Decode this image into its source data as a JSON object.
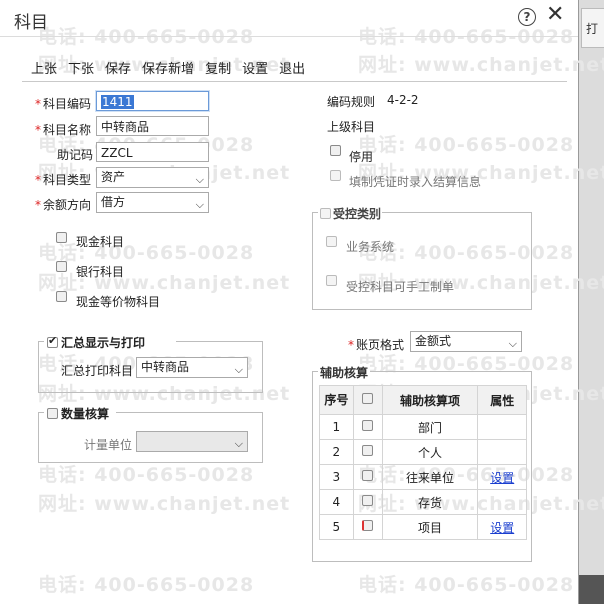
{
  "dialog": {
    "title": "科目",
    "help_glyph": "?",
    "close_glyph": "✕",
    "right_tab_label": "打"
  },
  "toolbar": [
    "上张",
    "下张",
    "保存",
    "保存新增",
    "复制",
    "设置",
    "退出"
  ],
  "watermark": {
    "phone": "电话: 400-665-0028",
    "site": "网址: www.chanjet.net"
  },
  "form": {
    "code_label": "科目编码",
    "code_value": "1411",
    "name_label": "科目名称",
    "name_value": "中转商品",
    "mnemonic_label": "助记码",
    "mnemonic_value": "ZZCL",
    "type_label": "科目类型",
    "type_value": "资产",
    "balance_label": "余额方向",
    "balance_value": "借方",
    "cash_label": "现金科目",
    "bank_label": "银行科目",
    "cash_equiv_label": "现金等价物科目",
    "summary_group": "汇总显示与打印",
    "summary_print_label": "汇总打印科目",
    "summary_print_value": "中转商品",
    "qty_group": "数量核算",
    "unit_label": "计量单位",
    "unit_value": ""
  },
  "right": {
    "code_rule_label": "编码规则",
    "code_rule_value": "4-2-2",
    "parent_label": "上级科目",
    "disabled_label": "停用",
    "voucher_label": "填制凭证时录入结算信息",
    "control_group": "受控类别",
    "business_label": "业务系统",
    "manual_label": "受控科目可手工制单",
    "ledger_label": "账页格式",
    "ledger_value": "金额式",
    "aux_group": "辅助核算"
  },
  "aux_table": {
    "headers": [
      "序号",
      "",
      "辅助核算项",
      "属性"
    ],
    "rows": [
      {
        "no": "1",
        "item": "部门",
        "attr": ""
      },
      {
        "no": "2",
        "item": "个人",
        "attr": ""
      },
      {
        "no": "3",
        "item": "往来单位",
        "attr": "设置"
      },
      {
        "no": "4",
        "item": "存货",
        "attr": ""
      },
      {
        "no": "5",
        "item": "项目",
        "attr": "设置"
      }
    ]
  },
  "icons": {
    "dropdown": "chevron-down-icon",
    "help": "help-icon",
    "close": "close-icon"
  }
}
